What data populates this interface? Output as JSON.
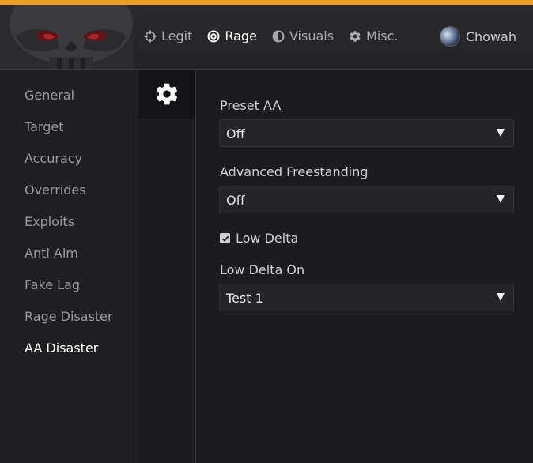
{
  "nav": {
    "items": [
      {
        "label": "Legit",
        "icon": "crosshair-icon",
        "active": false
      },
      {
        "label": "Rage",
        "icon": "target-icon",
        "active": true
      },
      {
        "label": "Visuals",
        "icon": "half-circle-icon",
        "active": false
      },
      {
        "label": "Misc.",
        "icon": "gear-icon",
        "active": false
      }
    ]
  },
  "user": {
    "name": "Chowah"
  },
  "sidebar": {
    "items": [
      {
        "label": "General"
      },
      {
        "label": "Target"
      },
      {
        "label": "Accuracy"
      },
      {
        "label": "Overrides"
      },
      {
        "label": "Exploits"
      },
      {
        "label": "Anti Aim"
      },
      {
        "label": "Fake Lag"
      },
      {
        "label": "Rage Disaster"
      },
      {
        "label": "AA Disaster"
      }
    ],
    "active_index": 8
  },
  "subtabs": [
    {
      "icon": "gear-icon",
      "active": true
    }
  ],
  "settings": {
    "preset_aa": {
      "label": "Preset AA",
      "value": "Off"
    },
    "advanced_freestanding": {
      "label": "Advanced Freestanding",
      "value": "Off"
    },
    "low_delta": {
      "label": "Low Delta",
      "checked": true
    },
    "low_delta_on": {
      "label": "Low Delta On",
      "value": "Test 1"
    }
  },
  "colors": {
    "accent": "#f39c1f",
    "background": "#1c1c1f",
    "text_active": "#ffffff",
    "text_inactive": "#9a9a9e"
  }
}
